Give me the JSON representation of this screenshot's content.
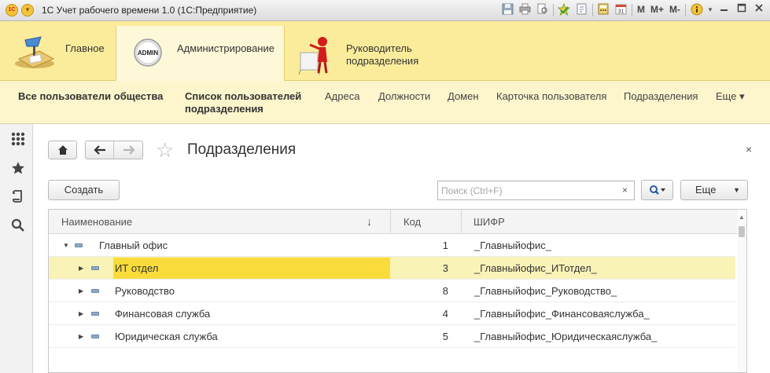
{
  "window": {
    "title": "1С Учет рабочего времени 1.0  (1С:Предприятие)",
    "logo_text": "1C",
    "toolbar_text_buttons": [
      "M",
      "M+",
      "M-"
    ]
  },
  "sections": [
    {
      "label": "Главное",
      "icon": "desk-lamp-icon"
    },
    {
      "label": "Администрирование",
      "icon": "admin-badge-icon",
      "icon_text": "ADMIN",
      "active": true
    },
    {
      "label": "Руководитель подразделения",
      "icon": "presenter-figure-icon"
    }
  ],
  "function_panel": {
    "items": [
      {
        "label": "Все пользователи общества",
        "bold": true
      },
      {
        "label": "Список пользователей подразделения",
        "bold": true
      },
      {
        "label": "Адреса"
      },
      {
        "label": "Должности"
      },
      {
        "label": "Домен"
      },
      {
        "label": "Карточка пользователя"
      },
      {
        "label": "Подразделения"
      },
      {
        "label": "Еще ▾"
      }
    ]
  },
  "left_panel": {
    "icons": [
      "apps-grid-icon",
      "favorites-star-icon",
      "history-icon",
      "search-icon"
    ]
  },
  "form": {
    "title": "Подразделения",
    "close_symbol": "×",
    "create_label": "Создать",
    "search_placeholder": "Поиск (Ctrl+F)",
    "search_clear": "×",
    "more_label": "Еще",
    "table": {
      "columns": [
        {
          "label": "Наименование",
          "sort_indicator": "↓"
        },
        {
          "label": "Код"
        },
        {
          "label": "ШИФР"
        }
      ],
      "rows": [
        {
          "name": "Главный офис",
          "code": "1",
          "cipher": "_Главныйофис_",
          "level": 0,
          "expanded": true
        },
        {
          "name": "ИТ отдел",
          "code": "3",
          "cipher": "_Главныйофис_ИТотдел_",
          "level": 1,
          "selected": true
        },
        {
          "name": "Руководство",
          "code": "8",
          "cipher": "_Главныйофис_Руководство_",
          "level": 1
        },
        {
          "name": "Финансовая служба",
          "code": "4",
          "cipher": "_Главныйофис_Финансоваяслужба_",
          "level": 1
        },
        {
          "name": "Юридическая служба",
          "code": "5",
          "cipher": "_Главныйофис_Юридическаяслужба_",
          "level": 1
        }
      ]
    }
  },
  "colors": {
    "section_bar": "#fbec9c",
    "function_bar": "#fdf5cc",
    "selected_row": "#faf3b8",
    "selected_cell": "#f9dc3a"
  }
}
